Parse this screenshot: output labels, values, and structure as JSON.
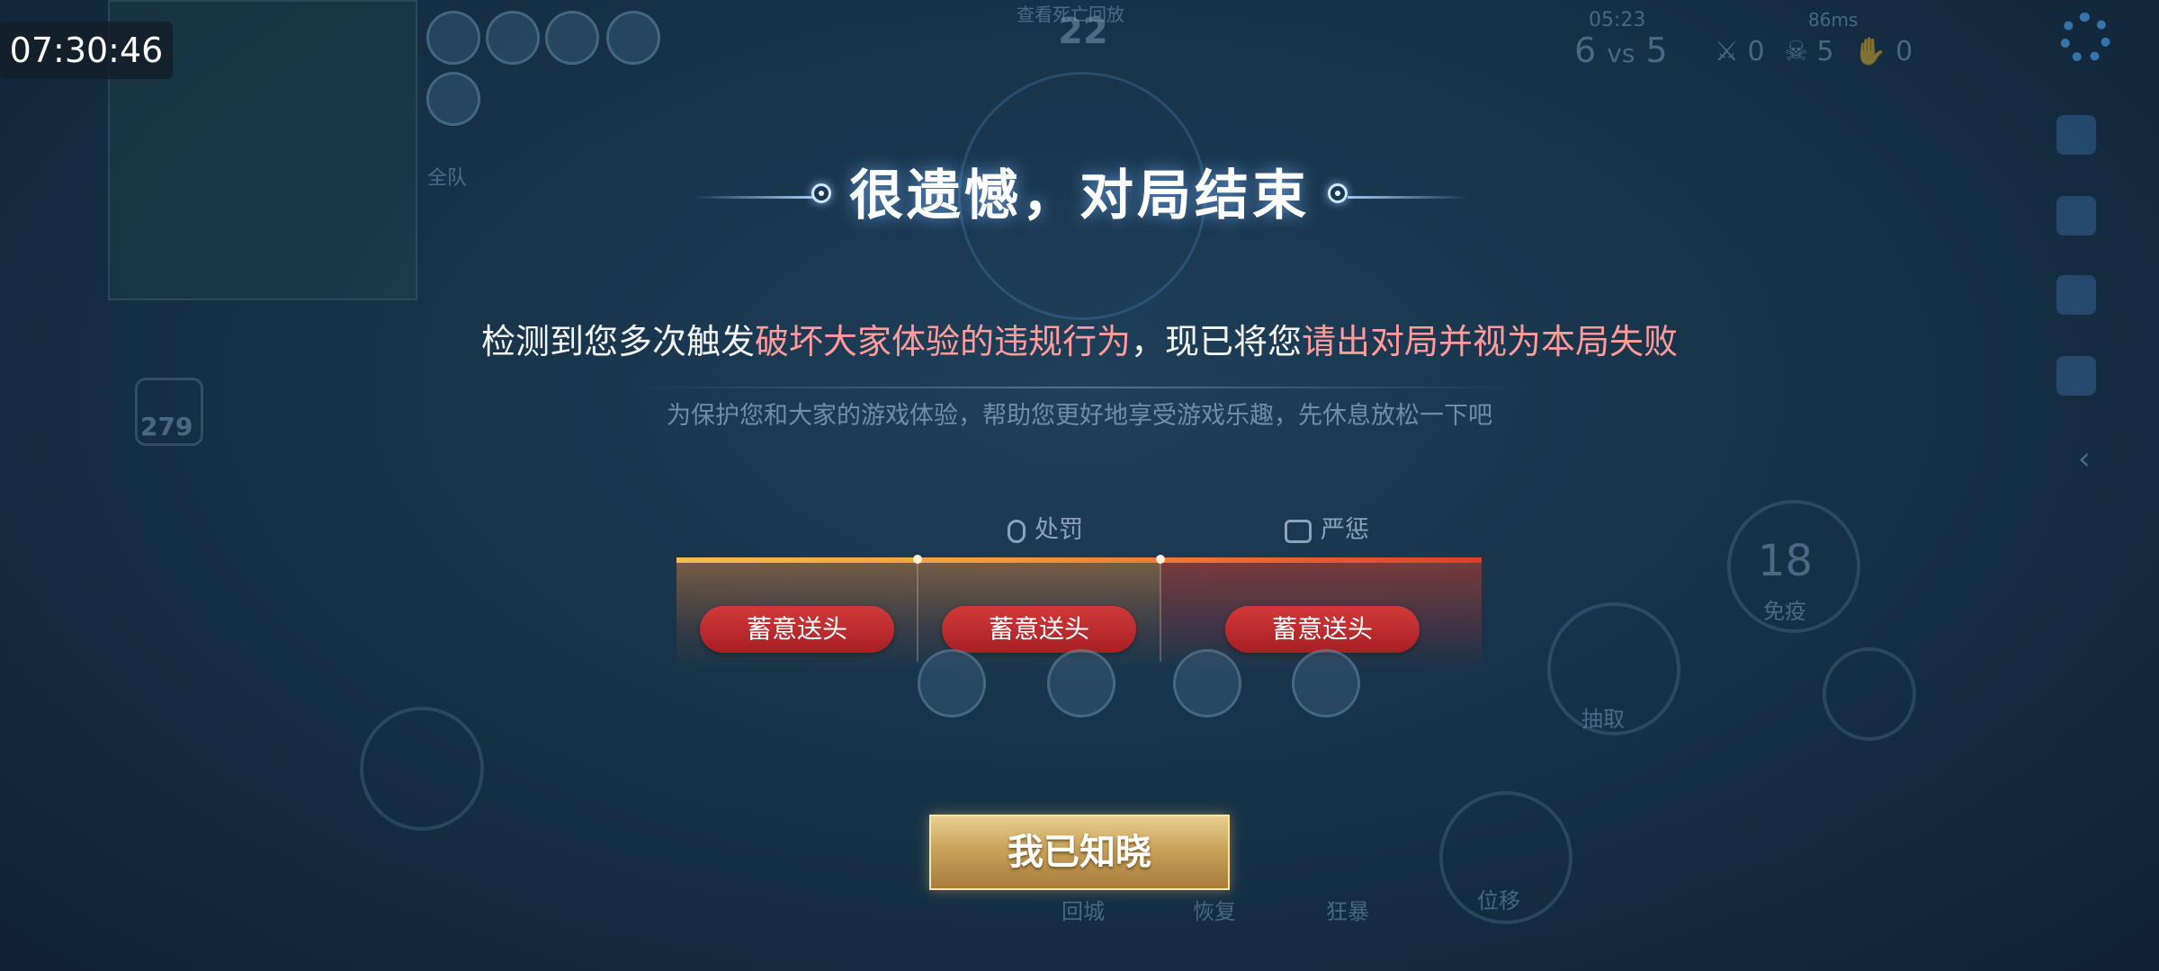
{
  "clock": "07:30:46",
  "hud": {
    "death_replay": "查看死亡回放",
    "death_timer": "22",
    "match_time": "05:23",
    "score_left": "6",
    "score_vs": "vs",
    "score_right": "5",
    "kills": "0",
    "deaths": "5",
    "assists": "0",
    "network": "86ms",
    "team_label": "全队",
    "gold": "279",
    "cooldown": "18",
    "immunity": "免疫",
    "draw": "抽取",
    "recall": "回城",
    "recover": "恢复",
    "frenzy": "狂暴",
    "dash": "位移"
  },
  "dialog": {
    "title": "很遗憾，对局结束",
    "message_part1": "检测到您多次触发",
    "message_highlight1": "破坏大家体验的违规行为",
    "message_part2": "，现已将您",
    "message_highlight2": "请出对局并视为本局失败",
    "subtext": "为保护您和大家的游戏体验，帮助您更好地享受游戏乐趣，先休息放松一下吧",
    "stages": [
      {
        "label": "处罚",
        "icon": "mute-mic-icon"
      },
      {
        "label": "严惩",
        "icon": "gamepad-ban-icon"
      }
    ],
    "violations": [
      "蓄意送头",
      "蓄意送头",
      "蓄意送头"
    ],
    "ack_button": "我已知晓"
  },
  "colors": {
    "highlight": "#ff9b9b",
    "badge": "#c02a2e",
    "button_gold": "#c9a25a"
  }
}
